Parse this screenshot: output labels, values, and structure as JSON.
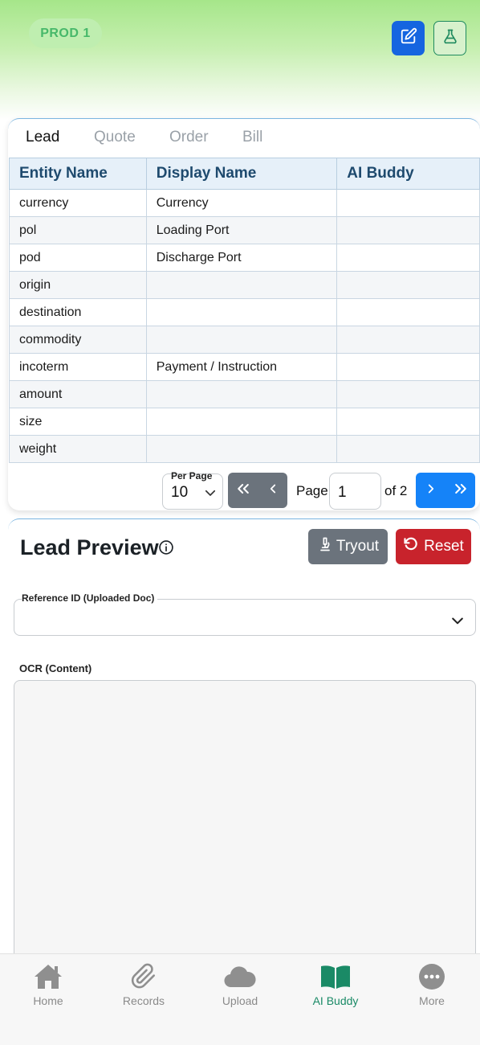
{
  "header": {
    "env_badge": "PROD 1",
    "edit_icon": "edit-icon",
    "lab_icon": "flask-icon"
  },
  "tabs": [
    {
      "label": "Lead",
      "active": true
    },
    {
      "label": "Quote",
      "active": false
    },
    {
      "label": "Order",
      "active": false
    },
    {
      "label": "Bill",
      "active": false
    }
  ],
  "table": {
    "columns": [
      "Entity Name",
      "Display Name",
      "AI Buddy"
    ],
    "rows": [
      [
        "currency",
        "Currency",
        ""
      ],
      [
        "pol",
        "Loading Port",
        ""
      ],
      [
        "pod",
        "Discharge Port",
        ""
      ],
      [
        "origin",
        "",
        ""
      ],
      [
        "destination",
        "",
        ""
      ],
      [
        "commodity",
        "",
        ""
      ],
      [
        "incoterm",
        "Payment / Instruction",
        ""
      ],
      [
        "amount",
        "",
        ""
      ],
      [
        "size",
        "",
        ""
      ],
      [
        "weight",
        "",
        ""
      ]
    ]
  },
  "pager": {
    "per_page_label": "Per Page",
    "per_page_value": "10",
    "page_label": "Page",
    "page_value": "1",
    "of_label": "of 2"
  },
  "preview": {
    "title": "Lead Preview",
    "tryout_label": "Tryout",
    "reset_label": "Reset",
    "reference_label": "Reference ID (Uploaded Doc)",
    "reference_value": "",
    "ocr_label": "OCR (Content)",
    "ocr_value": ""
  },
  "bottom_nav": [
    {
      "label": "Home",
      "icon": "home-icon",
      "active": false
    },
    {
      "label": "Records",
      "icon": "paperclip-icon",
      "active": false
    },
    {
      "label": "Upload",
      "icon": "cloud-icon",
      "active": false
    },
    {
      "label": "AI Buddy",
      "icon": "book-icon",
      "active": true
    },
    {
      "label": "More",
      "icon": "more-icon",
      "active": false
    }
  ],
  "colors": {
    "primary_blue": "#1565e0",
    "accent_green": "#1a8a66",
    "reset_red": "#c8232c",
    "neutral_gray": "#6b737c"
  }
}
